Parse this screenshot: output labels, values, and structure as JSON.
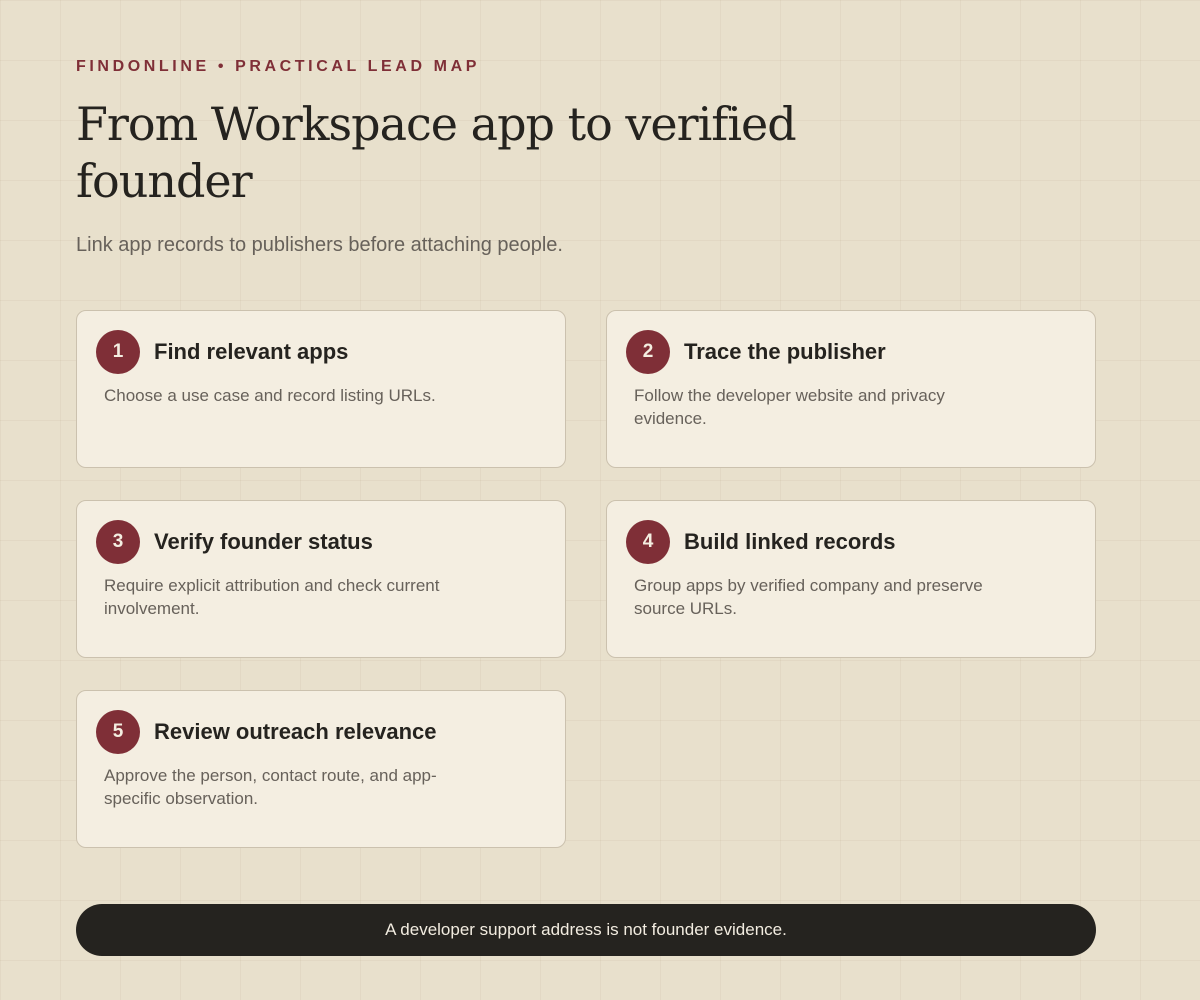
{
  "header": {
    "eyebrow": "FINDONLINE • PRACTICAL LEAD MAP",
    "title": "From Workspace app to verified founder",
    "subtitle": "Link app records to publishers before attaching people."
  },
  "steps": [
    {
      "number": "1",
      "title": "Find relevant apps",
      "description": "Choose a use case and record listing URLs."
    },
    {
      "number": "2",
      "title": "Trace the publisher",
      "description": "Follow the developer website and privacy evidence."
    },
    {
      "number": "3",
      "title": "Verify founder status",
      "description": "Require explicit attribution and check current involvement."
    },
    {
      "number": "4",
      "title": "Build linked records",
      "description": "Group apps by verified company and preserve source URLs."
    },
    {
      "number": "5",
      "title": "Review outreach relevance",
      "description": "Approve the person, contact route, and app-specific observation."
    }
  ],
  "footer": {
    "note": "A developer support address is not founder evidence."
  },
  "colors": {
    "background": "#e8e0cc",
    "card": "#f4eee1",
    "accent": "#7f2f37",
    "dark": "#25231f",
    "muted_text": "#67615a"
  }
}
